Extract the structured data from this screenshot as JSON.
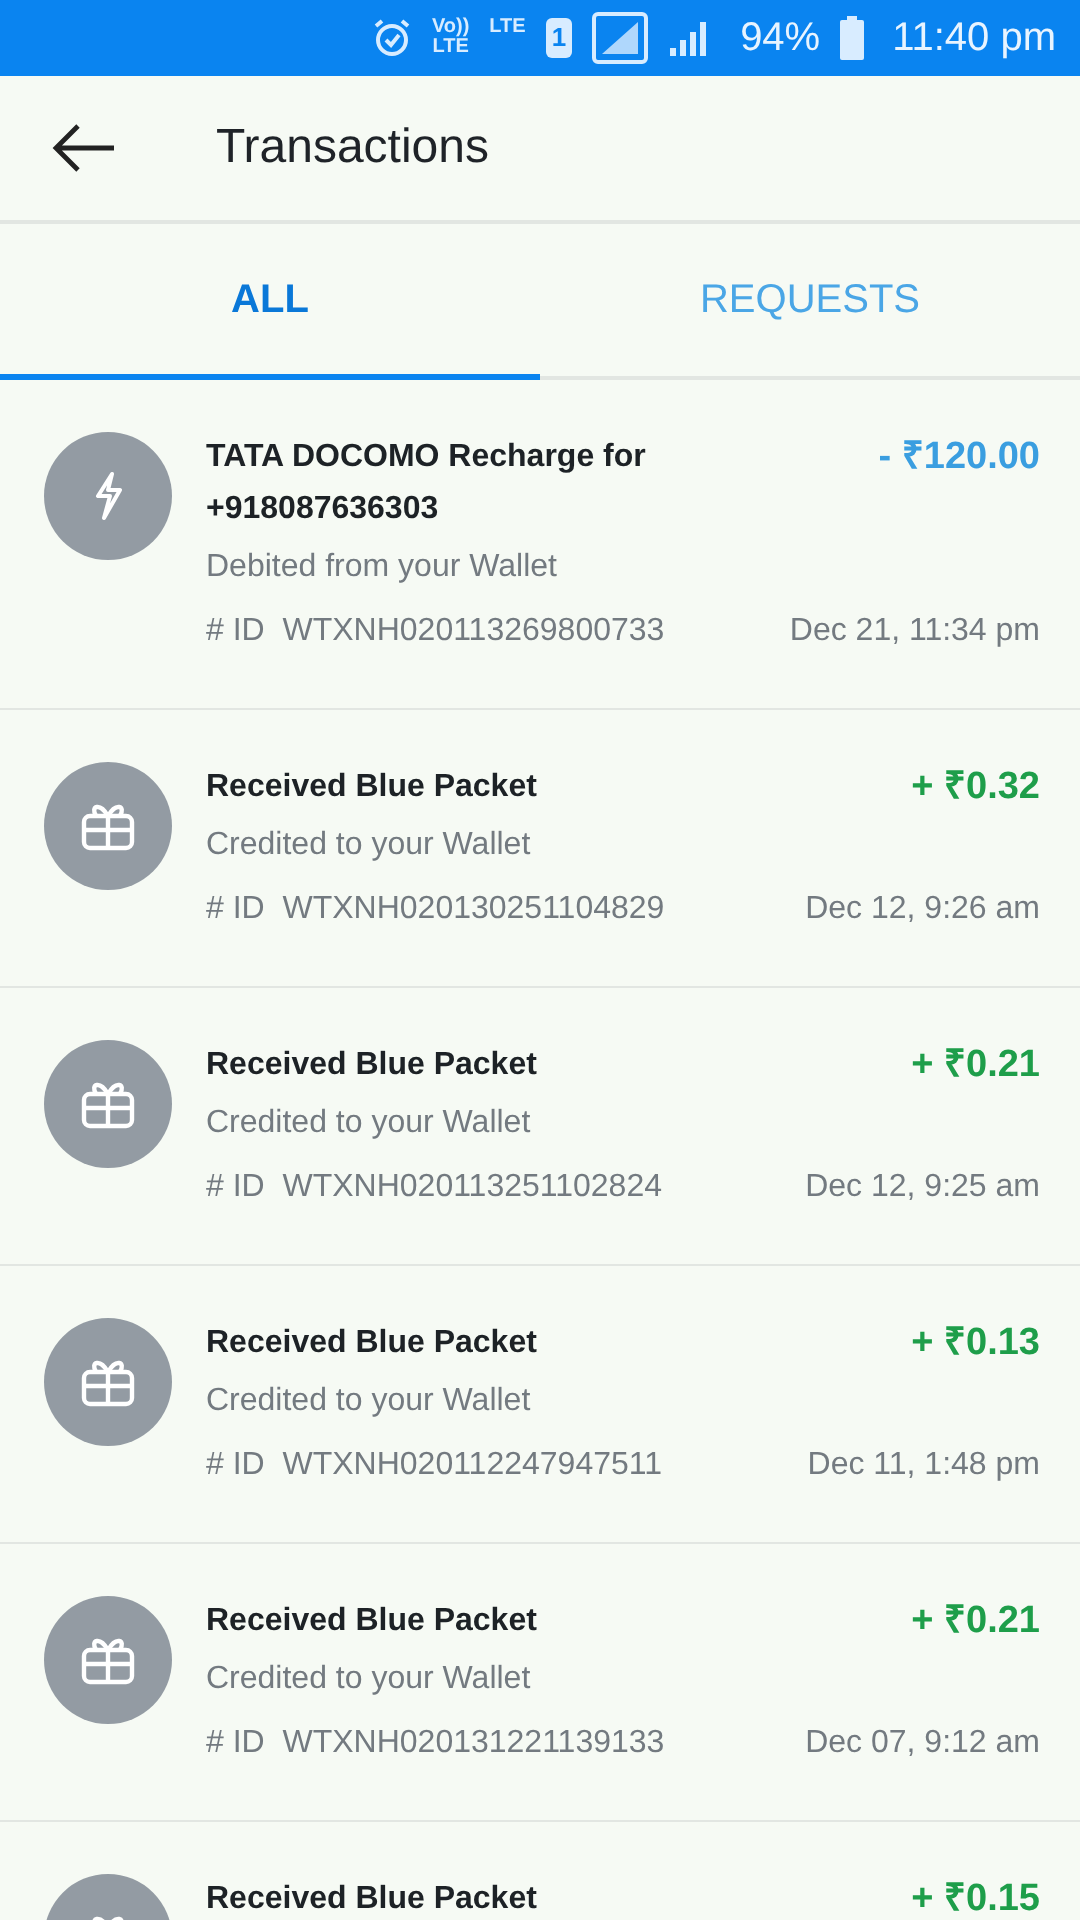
{
  "status_bar": {
    "volte_top": "Vo))",
    "volte_bottom": "LTE",
    "network": "LTE",
    "sim": "1",
    "battery": "94%",
    "time": "11:40 pm"
  },
  "header": {
    "title": "Transactions"
  },
  "tabs": [
    {
      "label": "ALL",
      "selected": true
    },
    {
      "label": "REQUESTS",
      "selected": false
    }
  ],
  "transactions": [
    {
      "kind": "recharge",
      "color": "#3a9ee0",
      "title": "TATA DOCOMO Recharge for +918087636303",
      "subtitle": "Debited from your Wallet",
      "id_label": "# ID",
      "id": "WTXNH020113269800733",
      "amount": "- ₹120.00",
      "date": "Dec 21, 11:34 pm"
    },
    {
      "kind": "gift",
      "color": "#1e9e4a",
      "title": "Received Blue Packet",
      "subtitle": "Credited to your Wallet",
      "id_label": "# ID",
      "id": "WTXNH020130251104829",
      "amount": "+ ₹0.32",
      "date": "Dec 12, 9:26 am"
    },
    {
      "kind": "gift",
      "color": "#1e9e4a",
      "title": "Received Blue Packet",
      "subtitle": "Credited to your Wallet",
      "id_label": "# ID",
      "id": "WTXNH020113251102824",
      "amount": "+ ₹0.21",
      "date": "Dec 12, 9:25 am"
    },
    {
      "kind": "gift",
      "color": "#1e9e4a",
      "title": "Received Blue Packet",
      "subtitle": "Credited to your Wallet",
      "id_label": "# ID",
      "id": "WTXNH020112247947511",
      "amount": "+ ₹0.13",
      "date": "Dec 11, 1:48 pm"
    },
    {
      "kind": "gift",
      "color": "#1e9e4a",
      "title": "Received Blue Packet",
      "subtitle": "Credited to your Wallet",
      "id_label": "# ID",
      "id": "WTXNH020131221139133",
      "amount": "+ ₹0.21",
      "date": "Dec 07, 9:12 am"
    },
    {
      "kind": "gift",
      "color": "#1e9e4a",
      "title": "Received Blue Packet",
      "amount": "+ ₹0.15"
    }
  ]
}
